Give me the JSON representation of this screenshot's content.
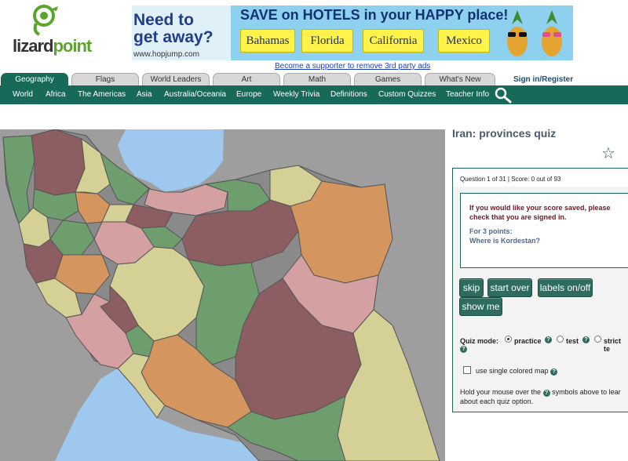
{
  "brand": {
    "lizard": "lizard",
    "point": "point"
  },
  "ad": {
    "line1": "Need to",
    "line2": "get away?",
    "url": "www.hopjump.com",
    "headline": "SAVE on HOTELS in your HAPPY place!",
    "destinations": [
      "Bahamas",
      "Florida",
      "California",
      "Mexico"
    ]
  },
  "supporter_link": "Become a supporter to remove 3rd party ads",
  "tabs": [
    "Geography",
    "Flags",
    "World Leaders",
    "Art",
    "Math",
    "Games",
    "What's New"
  ],
  "signin": "Sign in/Register",
  "nav": [
    "World",
    "Africa",
    "The Americas",
    "Asia",
    "Australia/Oceania",
    "Europe",
    "Weekly Trivia",
    "Definitions",
    "Custom Quizzes",
    "Teacher Info"
  ],
  "quiz": {
    "title": "Iran: provinces quiz",
    "status": "Question 1 of 31 | Score: 0 out of 93",
    "signin_warning": "If you would like your score saved, please check that you are signed in.",
    "points_label": "For 3 points:",
    "question": "Where is Kordestan?",
    "buttons": {
      "skip": "skip",
      "start_over": "start over",
      "labels": "labels on/off",
      "show_me": "show me"
    },
    "mode_label": "Quiz mode:",
    "modes": [
      "practice",
      "test",
      "strict te"
    ],
    "single_color": "use single colored map",
    "hint": "Hold your mouse over the",
    "hint_tail": "symbols above to lear",
    "hint_line2": "about each quiz option.",
    "help_glyph": "?"
  },
  "colors": {
    "accent": "#17695a",
    "link": "#1a3cc4",
    "warning": "#7a1420",
    "question": "#4c6a9a"
  },
  "icons": [
    "lizard-logo-icon",
    "search-icon",
    "star-icon",
    "help-icon",
    "pineapple-icon"
  ]
}
